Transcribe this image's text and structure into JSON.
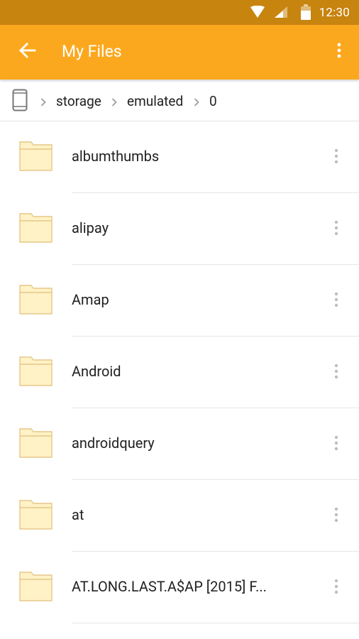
{
  "status_bar": {
    "time": "12:30",
    "icons": [
      "wifi-icon",
      "cellular-signal-icon",
      "battery-icon"
    ]
  },
  "app_bar": {
    "title": "My Files",
    "back_icon": "arrow-back-icon",
    "overflow_icon": "more-vertical-icon"
  },
  "breadcrumb": {
    "root_icon": "phone-device-icon",
    "separator_icon": "chevron-right-icon",
    "segments": [
      "storage",
      "emulated",
      "0"
    ]
  },
  "files": [
    {
      "name": "albumthumbs",
      "type": "folder"
    },
    {
      "name": "alipay",
      "type": "folder"
    },
    {
      "name": "Amap",
      "type": "folder"
    },
    {
      "name": "Android",
      "type": "folder"
    },
    {
      "name": "androidquery",
      "type": "folder"
    },
    {
      "name": "at",
      "type": "folder"
    },
    {
      "name": "AT.LONG.LAST.A$AP [2015] F...",
      "type": "folder"
    }
  ],
  "colors": {
    "status_bar": "#C7840F",
    "app_bar": "#FCA81E",
    "folder_fill": "#FFF2C6",
    "folder_stroke": "#E5C888"
  }
}
